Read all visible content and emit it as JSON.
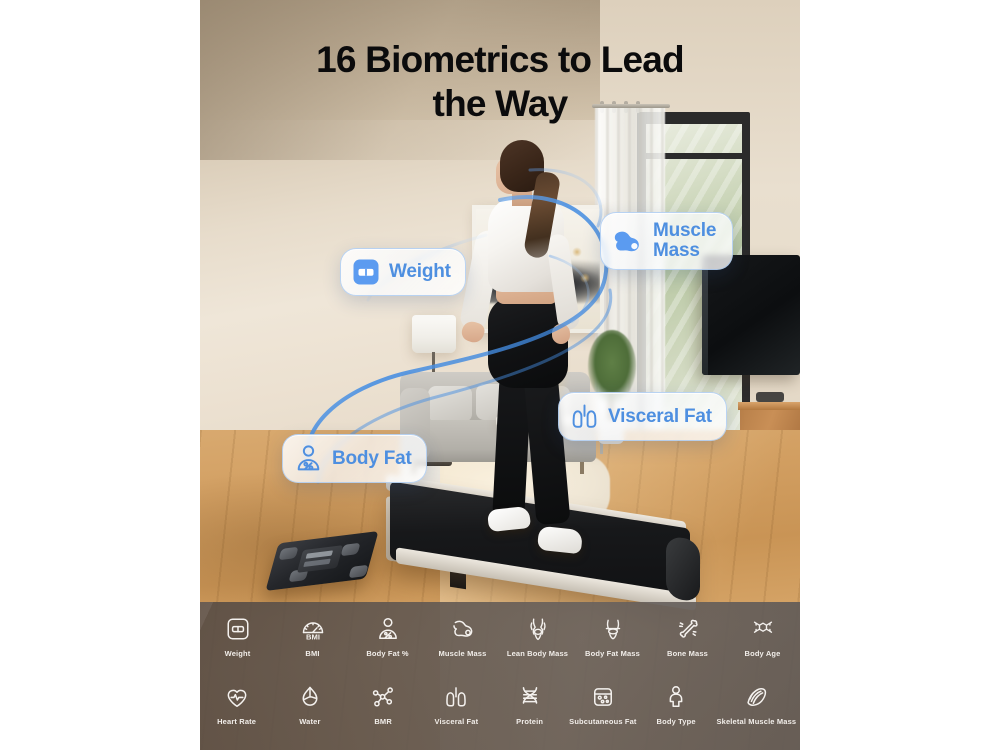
{
  "headline": {
    "text": "16 Biometrics to Lead\nthe Way"
  },
  "theme": {
    "accent_blue": "#4e8fe0",
    "icon_blue": "#5b9bf0",
    "strip_bg": "#605650",
    "headline_color": "#0b0b0c",
    "page_bg": "#ffffff"
  },
  "badges": [
    {
      "label": "Weight",
      "icon": "scale-icon",
      "style": "filled"
    },
    {
      "label": "Muscle\nMass",
      "icon": "bicep-icon",
      "style": "filled"
    },
    {
      "label": "Visceral Fat",
      "icon": "lungs-icon",
      "style": "outline"
    },
    {
      "label": "Body Fat",
      "icon": "person-percent-icon",
      "style": "outline"
    }
  ],
  "metrics_strip": {
    "row1": [
      {
        "label": "Weight",
        "icon": "scale-icon"
      },
      {
        "label": "BMI",
        "icon": "bmi-gauge-icon"
      },
      {
        "label": "Body Fat %",
        "icon": "person-percent-icon"
      },
      {
        "label": "Muscle Mass",
        "icon": "bicep-icon"
      },
      {
        "label": "Lean Body Mass",
        "icon": "torso-icon"
      },
      {
        "label": "Body Fat Mass",
        "icon": "waist-icon"
      },
      {
        "label": "Bone Mass",
        "icon": "bone-icon"
      },
      {
        "label": "Body Age",
        "icon": "molecule-hex-icon"
      }
    ],
    "row2": [
      {
        "label": "Heart Rate",
        "icon": "heart-pulse-icon"
      },
      {
        "label": "Water",
        "icon": "water-drop-icon"
      },
      {
        "label": "BMR",
        "icon": "molecule-node-icon"
      },
      {
        "label": "Visceral Fat",
        "icon": "lungs-icon"
      },
      {
        "label": "Protein",
        "icon": "dna-icon"
      },
      {
        "label": "Subcutaneous Fat",
        "icon": "jar-icon"
      },
      {
        "label": "Body Type",
        "icon": "body-figure-icon"
      },
      {
        "label": "Skeletal Muscle Mass",
        "icon": "muscle-fiber-icon"
      }
    ]
  },
  "scene": {
    "description": "Woman walking on a treadmill in a modern living room",
    "objects": [
      "treadmill",
      "smart-scale",
      "sofa",
      "wall-art",
      "floor-lamp",
      "window",
      "tv",
      "plant",
      "sideboard",
      "rug",
      "coffee-table"
    ]
  }
}
